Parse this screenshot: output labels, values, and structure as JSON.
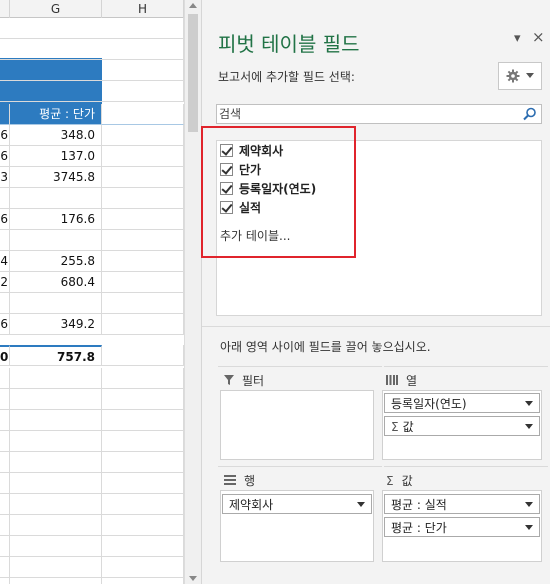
{
  "sheet": {
    "columns": {
      "g": "G",
      "h": "H"
    },
    "header_cell": "평균 : 단가",
    "rows": [
      {
        "left": "6",
        "g": "348.0"
      },
      {
        "left": "6",
        "g": "137.0"
      },
      {
        "left": "3",
        "g": "3745.8"
      },
      {
        "left": "",
        "g": ""
      },
      {
        "left": "6",
        "g": "176.6"
      },
      {
        "left": "",
        "g": ""
      },
      {
        "left": "4",
        "g": "255.8"
      },
      {
        "left": "2",
        "g": "680.4"
      },
      {
        "left": "",
        "g": ""
      },
      {
        "left": "6",
        "g": "349.2"
      }
    ],
    "total": {
      "left": "0",
      "g": "757.8"
    }
  },
  "pane": {
    "title": "피벗 테이블 필드",
    "ctrl_menu": "▾",
    "ctrl_close": "×",
    "subtitle": "보고서에 추가할 필드 선택:",
    "search_placeholder": "검색",
    "fields": [
      {
        "label": "제약회사",
        "checked": true
      },
      {
        "label": "단가",
        "checked": true
      },
      {
        "label": "등록일자(연도)",
        "checked": true
      },
      {
        "label": "실적",
        "checked": true
      }
    ],
    "more_tables": "추가 테이블...",
    "drag_hint": "아래 영역 사이에 필드를 끌어 놓으십시오.",
    "zones": {
      "filter": {
        "label": "필터"
      },
      "columns": {
        "label": "열",
        "items": [
          "등록일자(연도)",
          "값"
        ]
      },
      "rows": {
        "label": "행",
        "items": [
          "제약회사"
        ]
      },
      "values": {
        "label": "값",
        "items": [
          "평균 : 실적",
          "평균 : 단가"
        ]
      }
    }
  },
  "icons": {
    "filter": "filter-icon",
    "columns": "columns-icon",
    "rows": "rows-icon",
    "values": "sigma-icon",
    "gear": "gear-icon",
    "search": "search-icon"
  },
  "colors": {
    "title_green": "#217346",
    "pivot_blue": "#2d7bc0",
    "highlight_red": "#e0242c"
  }
}
